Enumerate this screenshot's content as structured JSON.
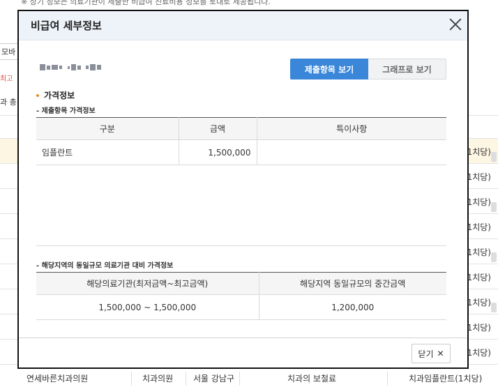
{
  "background": {
    "top_note": "※ 상기 정보는 의료기관이 제출한 비급여 진료비용 정보를 토대로 제공됩니다.",
    "left_label_a": "모바",
    "left_label_b": "최고",
    "left_label_c": "과 총",
    "right_cells": [
      "1치당)",
      "1치당)",
      "1치당)",
      "1치당)",
      "1치당)",
      "1치당)",
      "1치당)",
      "1치당)",
      "1치당)"
    ],
    "bottom_row": {
      "hospital": "연세바른치과의원",
      "type": "치과의원",
      "region": "서울 강남구",
      "category": "치과의 보철료",
      "item": "치과임플란트(1치당)"
    }
  },
  "modal": {
    "title": "비급여 세부정보",
    "tabs": {
      "submitted": "제출항목 보기",
      "graph": "그래프로 보기"
    },
    "section_title": "가격정보",
    "price_table": {
      "subtitle": "- 제출항목 가격정보",
      "headers": [
        "구분",
        "금액",
        "특이사항"
      ],
      "rows": [
        {
          "category": "임플란트",
          "amount": "1,500,000",
          "note": ""
        }
      ]
    },
    "compare_table": {
      "subtitle": "- 해당지역의 동일규모 의료기관 대비 가격정보",
      "headers": [
        "해당의료기관(최저금액~최고금액)",
        "해당지역 동일규모의 중간금액"
      ],
      "row": {
        "range": "1,500,000 ~ 1,500,000",
        "median": "1,200,000"
      }
    },
    "close_label": "닫기"
  }
}
